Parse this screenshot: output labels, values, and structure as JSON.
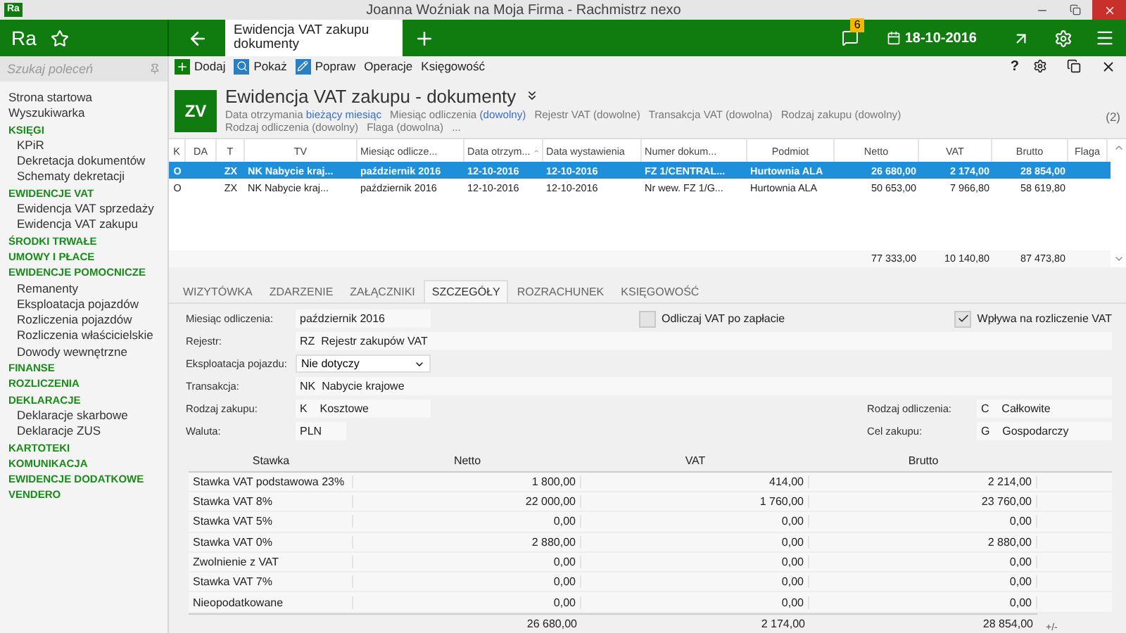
{
  "window": {
    "title": "Joanna Woźniak na Moja Firma - Rachmistrz nexo",
    "logo": "Ra"
  },
  "topbar": {
    "logo": "Ra",
    "tab": "Ewidencja VAT zakupu dokumenty",
    "notifications": "6",
    "date": "18-10-2016"
  },
  "sidebar": {
    "search_placeholder": "Szukaj poleceń",
    "items": [
      {
        "label": "Strona startowa",
        "kind": "link"
      },
      {
        "label": "Wyszukiwarka",
        "kind": "link"
      },
      {
        "label": "KSIĘGI",
        "kind": "section",
        "children": [
          {
            "label": "KPiR"
          },
          {
            "label": "Dekretacja dokumentów"
          },
          {
            "label": "Schematy dekretacji"
          }
        ]
      },
      {
        "label": "EWIDENCJE VAT",
        "kind": "section",
        "children": [
          {
            "label": "Ewidencja VAT sprzedaży"
          },
          {
            "label": "Ewidencja VAT zakupu"
          }
        ]
      },
      {
        "label": "ŚRODKI TRWAŁE",
        "kind": "section"
      },
      {
        "label": "UMOWY I PŁACE",
        "kind": "section"
      },
      {
        "label": "EWIDENCJE POMOCNICZE",
        "kind": "section",
        "children": [
          {
            "label": "Remanenty"
          },
          {
            "label": "Eksploatacja pojazdów"
          },
          {
            "label": "Rozliczenia pojazdów"
          },
          {
            "label": "Rozliczenia właścicielskie"
          },
          {
            "label": "Dowody wewnętrzne"
          }
        ]
      },
      {
        "label": "FINANSE",
        "kind": "section"
      },
      {
        "label": "ROZLICZENIA",
        "kind": "section"
      },
      {
        "label": "DEKLARACJE",
        "kind": "section",
        "children": [
          {
            "label": "Deklaracje skarbowe"
          },
          {
            "label": "Deklaracje ZUS"
          }
        ]
      },
      {
        "label": "KARTOTEKI",
        "kind": "section"
      },
      {
        "label": "KOMUNIKACJA",
        "kind": "section"
      },
      {
        "label": "EWIDENCJE DODATKOWE",
        "kind": "section"
      },
      {
        "label": "VENDERO",
        "kind": "section"
      }
    ]
  },
  "toolbar": {
    "buttons": [
      {
        "label": "Dodaj",
        "kind": "add"
      },
      {
        "label": "Pokaż",
        "kind": "view"
      },
      {
        "label": "Popraw",
        "kind": "edit"
      },
      {
        "label": "Operacje",
        "kind": "plain"
      },
      {
        "label": "Księgowość",
        "kind": "plain"
      }
    ],
    "help": "?"
  },
  "header": {
    "badge": "ZV",
    "title": "Ewidencja VAT zakupu - dokumenty",
    "count": "(2)",
    "more": "...",
    "filters": [
      {
        "label": "Data otrzymania",
        "value": "bieżący miesiąc",
        "highlighted": true
      },
      {
        "label": "Miesiąc odliczenia",
        "value": "(dowolny)",
        "highlighted": true
      },
      {
        "label": "Rejestr VAT",
        "value": "(dowolne)",
        "highlighted": false
      },
      {
        "label": "Transakcja VAT",
        "value": "(dowolna)",
        "highlighted": false
      },
      {
        "label": "Rodzaj zakupu",
        "value": "(dowolny)",
        "highlighted": false
      },
      {
        "label": "Rodzaj odliczenia",
        "value": "(dowolny)",
        "highlighted": false
      },
      {
        "label": "Flaga",
        "value": "(dowolna)",
        "highlighted": false
      }
    ]
  },
  "grid": {
    "columns": [
      {
        "label": "K",
        "sorted": false
      },
      {
        "label": "DA",
        "sorted": false
      },
      {
        "label": "T",
        "sorted": false
      },
      {
        "label": "TV",
        "sorted": false
      },
      {
        "label": "Miesiąc odlicze...",
        "sorted": false
      },
      {
        "label": "Data otrzym...",
        "sorted": true
      },
      {
        "label": "Data wystawienia",
        "sorted": false
      },
      {
        "label": "Numer dokum...",
        "sorted": false
      },
      {
        "label": "Podmiot",
        "sorted": false
      },
      {
        "label": "Netto",
        "sorted": false
      },
      {
        "label": "VAT",
        "sorted": false
      },
      {
        "label": "Brutto",
        "sorted": false
      },
      {
        "label": "Flaga",
        "sorted": false
      }
    ],
    "rows": [
      {
        "selected": true,
        "cells": [
          "O",
          "",
          "ZX",
          "NK Nabycie kraj...",
          "październik 2016",
          "12-10-2016",
          "12-10-2016",
          "FZ 1/CENTRAL...",
          "Hurtownia ALA",
          "26 680,00",
          "2 174,00",
          "28 854,00",
          ""
        ]
      },
      {
        "selected": false,
        "cells": [
          "O",
          "",
          "ZX",
          "NK Nabycie kraj...",
          "październik 2016",
          "12-10-2016",
          "12-10-2016",
          "Nr wew. FZ 1/G...",
          "Hurtownia ALA",
          "50 653,00",
          "7 966,80",
          "58 619,80",
          ""
        ]
      }
    ],
    "totals": {
      "netto": "77 333,00",
      "vat": "10 140,80",
      "brutto": "87 473,80"
    }
  },
  "detail_tabs": [
    {
      "label": "WIZYTÓWKA",
      "selected": false
    },
    {
      "label": "ZDARZENIE",
      "selected": false
    },
    {
      "label": "ZAŁĄCZNIKI",
      "selected": false
    },
    {
      "label": "SZCZEGÓŁY",
      "selected": true
    },
    {
      "label": "ROZRACHUNEK",
      "selected": false
    },
    {
      "label": "KSIĘGOWOŚĆ",
      "selected": false
    }
  ],
  "details": {
    "month": {
      "label": "Miesiąc odliczenia:",
      "value": "październik 2016"
    },
    "vat_after_payment": {
      "label": "Odliczaj VAT po zapłacie",
      "checked": false
    },
    "affects_vat": {
      "label": "Wpływa na rozliczenie VAT",
      "checked": true
    },
    "register": {
      "label": "Rejestr:",
      "code": "RZ",
      "value": "Rejestr zakupów VAT"
    },
    "vehicle": {
      "label": "Eksploatacja pojazdu:",
      "value": "Nie dotyczy"
    },
    "transaction": {
      "label": "Transakcja:",
      "code": "NK",
      "value": "Nabycie krajowe"
    },
    "purchase_type": {
      "label": "Rodzaj zakupu:",
      "code": "K",
      "value": "Kosztowe"
    },
    "deduction_type": {
      "label": "Rodzaj odliczenia:",
      "code": "C",
      "value": "Całkowite"
    },
    "currency": {
      "label": "Waluta:",
      "value": "PLN"
    },
    "purpose": {
      "label": "Cel zakupu:",
      "code": "G",
      "value": "Gospodarczy"
    }
  },
  "vat_table": {
    "columns": [
      "Stawka",
      "Netto",
      "VAT",
      "Brutto"
    ],
    "rows": [
      [
        "Stawka VAT podstawowa 23%",
        "1 800,00",
        "414,00",
        "2 214,00"
      ],
      [
        "Stawka VAT 8%",
        "22 000,00",
        "1 760,00",
        "23 760,00"
      ],
      [
        "Stawka VAT 5%",
        "0,00",
        "0,00",
        "0,00"
      ],
      [
        "Stawka VAT 0%",
        "2 880,00",
        "0,00",
        "2 880,00"
      ],
      [
        "Zwolnienie z VAT",
        "0,00",
        "0,00",
        "0,00"
      ],
      [
        "Stawka VAT 7%",
        "0,00",
        "0,00",
        "0,00"
      ],
      [
        "Nieopodatkowane",
        "0,00",
        "0,00",
        "0,00"
      ]
    ],
    "totals": {
      "netto": "26 680,00",
      "vat": "2 174,00",
      "brutto": "28 854,00"
    },
    "toggle": "+/-"
  }
}
